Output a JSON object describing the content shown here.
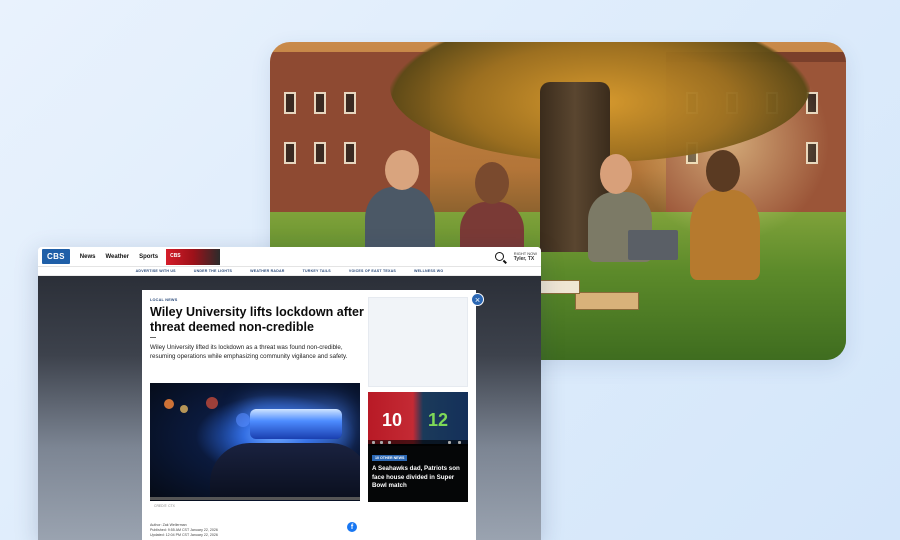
{
  "navbar": {
    "logo": "CBS",
    "items": [
      "News",
      "Weather",
      "Sports"
    ],
    "promo_badge": "CBS",
    "weather": {
      "line1": "RIGHT NOW",
      "line2": "Tyler, TX"
    }
  },
  "subnav": {
    "items": [
      "ADVERTISE WITH US",
      "UNDER THE LIGHTS",
      "WEATHER RADAR",
      "TURKEY TAILS",
      "VOICES OF EAST TEXAS",
      "WELLNESS WO"
    ]
  },
  "article": {
    "kicker": "LOCAL NEWS",
    "headline": "Wiley University lifts lockdown after threat deemed non-credible",
    "summary": "Wiley University lifted its lockdown as a threat was found non-credible, resuming operations while emphasizing community vigilance and safety.",
    "caption": "CREDIT: CTX",
    "byline": {
      "author": "Author: Zak Wellerman",
      "published": "Published: 9:55 AM CST January 22, 2026",
      "updated": "Updated: 12:04 PM CST January 22, 2026"
    }
  },
  "video": {
    "badge": "10 OTHER NEWS",
    "title": "A Seahawks dad, Patriots son face house divided in Super Bowl match",
    "jersey_left": "10",
    "jersey_right": "12"
  },
  "modal": {
    "close": "×"
  },
  "colors": {
    "brand": "#1f5fa8",
    "close": "#2b67b3",
    "facebook": "#1877f2"
  }
}
